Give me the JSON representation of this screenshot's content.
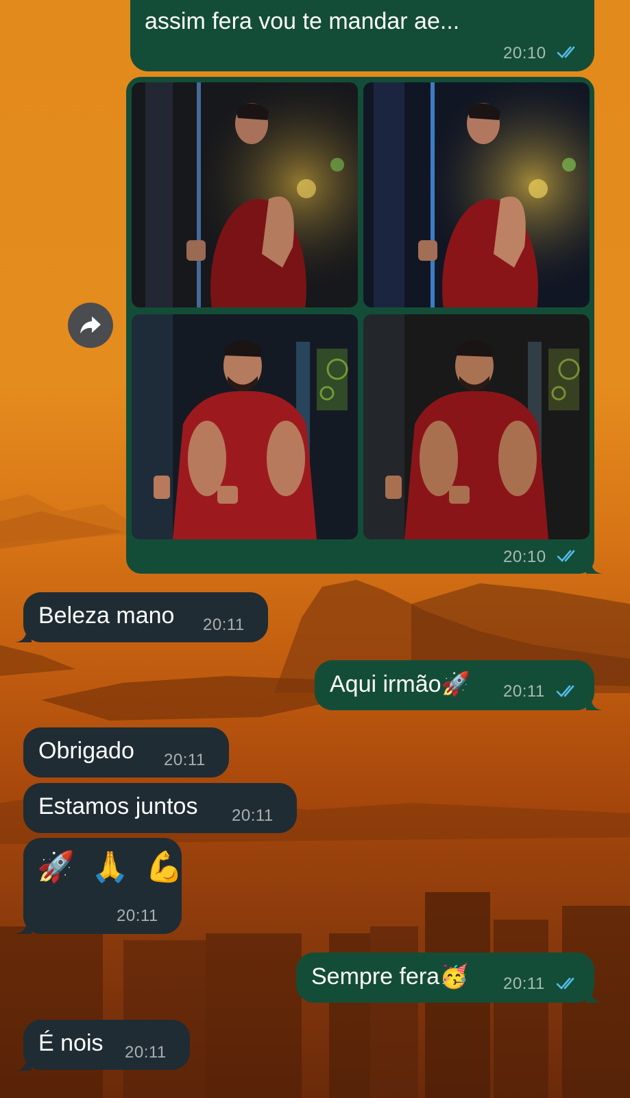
{
  "messages": [
    {
      "text": "assim fera vou te mandar ae...",
      "time": "20:10",
      "direction": "out"
    },
    {
      "type": "album",
      "time": "20:10",
      "direction": "out"
    },
    {
      "text": "Beleza mano",
      "time": "20:11",
      "direction": "in"
    },
    {
      "text": "Aqui irmão🚀",
      "time": "20:11",
      "direction": "out"
    },
    {
      "text": "Obrigado",
      "time": "20:11",
      "direction": "in"
    },
    {
      "text": "Estamos juntos",
      "time": "20:11",
      "direction": "in"
    },
    {
      "text": "🚀 🙏 💪",
      "time": "20:11",
      "direction": "in"
    },
    {
      "text": "Sempre fera🥳",
      "time": "20:11",
      "direction": "out"
    },
    {
      "text": "É nois",
      "time": "20:11",
      "direction": "in"
    }
  ],
  "icons": {
    "share": "forward-arrow-icon",
    "read": "double-check-icon"
  },
  "colors": {
    "outgoing_bubble": "#144d37",
    "incoming_bubble": "#1f2c33",
    "read_ticks": "#53bdeb",
    "wallpaper": "#e38a1c"
  }
}
